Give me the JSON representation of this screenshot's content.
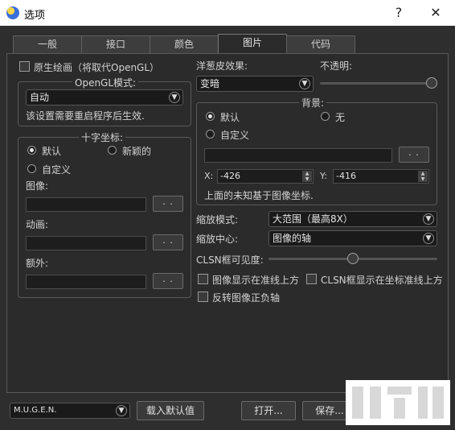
{
  "window": {
    "title": "选项",
    "help": "?",
    "close": "✕"
  },
  "tabs": [
    {
      "label": "一般"
    },
    {
      "label": "接口"
    },
    {
      "label": "颜色"
    },
    {
      "label": "图片"
    },
    {
      "label": "代码"
    }
  ],
  "left": {
    "native_draw": "原生绘画（将取代OpenGL）",
    "opengl_group": "OpenGL模式:",
    "opengl_mode": "自动",
    "restart_note": "该设置需要重启程序后生效.",
    "cross_group": "十字坐标:",
    "radio_default": "默认",
    "radio_new": "新颖的",
    "radio_custom": "自定义",
    "image_label": "图像:",
    "anim_label": "动画:",
    "extra_label": "额外:",
    "browse": ". ."
  },
  "right": {
    "onion_label": "洋葱皮效果:",
    "onion_value": "变暗",
    "opacity_label": "不透明:",
    "opacity_level": 0.95,
    "bg_group": "背景:",
    "bg_default": "默认",
    "bg_none": "无",
    "bg_custom": "自定义",
    "browse": ". .",
    "x_label": "X:",
    "x_value": "-426",
    "y_label": "Y:",
    "y_value": "-416",
    "coord_note": "上面的未知基于图像坐标.",
    "zoom_mode_label": "缩放模式:",
    "zoom_mode_value": "大范围（最高8X）",
    "zoom_center_label": "缩放中心:",
    "zoom_center_value": "图像的轴",
    "clsn_vis_label": "CLSN框可见度:",
    "clsn_level": 0.5,
    "chk_img_above": "图像显示在准线上方",
    "chk_clsn_above": "CLSN框显示在坐标准线上方",
    "chk_invert": "反转图像正负轴"
  },
  "footer": {
    "profile": "M.U.G.E.N.",
    "load_default": "载入默认值",
    "open": "打开...",
    "save": "保存..."
  }
}
